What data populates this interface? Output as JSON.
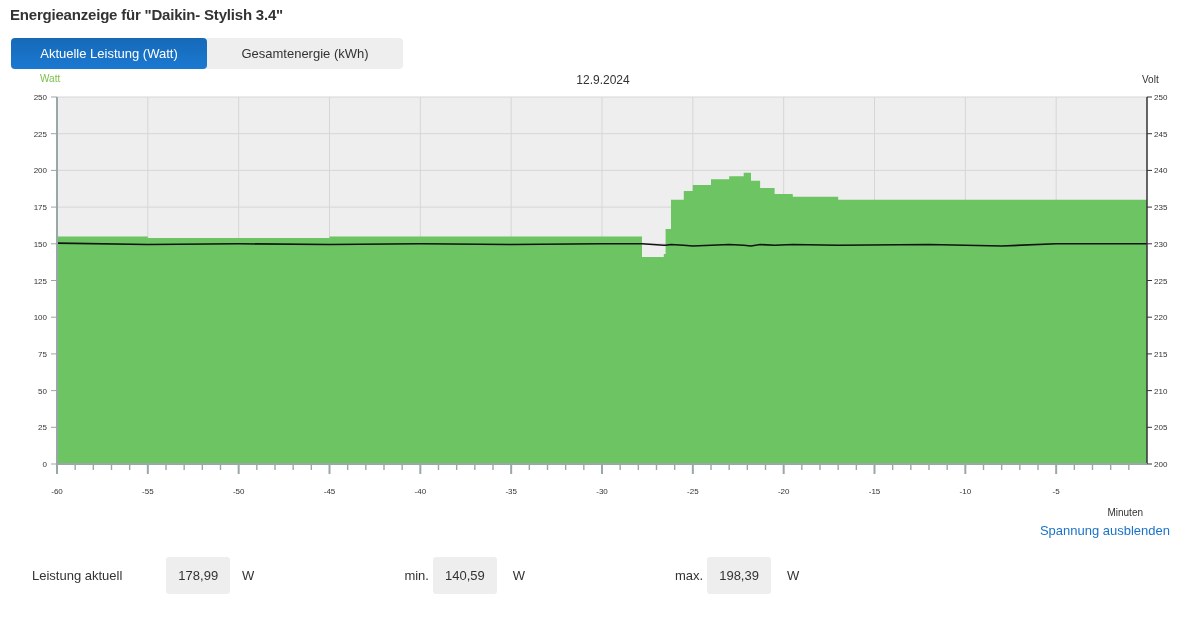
{
  "title": "Energieanzeige für \"Daikin- Stylish 3.4\"",
  "tabs": [
    {
      "label": "Aktuelle Leistung (Watt)",
      "selected": true
    },
    {
      "label": "Gesamtenergie (kWh)",
      "selected": false
    }
  ],
  "chart": {
    "chart_data": {
      "type": "area",
      "title": "12.9.2024",
      "xlabel": "Minuten",
      "ylabel": "Watt",
      "y2label": "Volt",
      "x": [
        -60,
        -55,
        -50,
        -45,
        -40,
        -35,
        -30,
        -28,
        -27.8,
        -26.6,
        -26.5,
        -26.2,
        -25.5,
        -25,
        -24,
        -23,
        -22.2,
        -21.8,
        -21.3,
        -20.5,
        -19.5,
        -17,
        -12,
        -8,
        -5,
        -2,
        0
      ],
      "series": [
        {
          "color": "#6cc463",
          "values": [
            155,
            154,
            154,
            155,
            155,
            155,
            155,
            155,
            141,
            143,
            160,
            180,
            186,
            190,
            194,
            196,
            198.4,
            193,
            188,
            184,
            182,
            180,
            180,
            180,
            180,
            180,
            179
          ]
        },
        {
          "type": "line",
          "color": "#111111",
          "axis": "y2",
          "values": [
            230.1,
            229.9,
            230,
            229.9,
            230,
            229.9,
            230,
            230,
            230,
            229.8,
            229.8,
            229.9,
            229.8,
            229.7,
            229.8,
            229.9,
            229.8,
            229.7,
            229.9,
            229.8,
            229.9,
            229.8,
            229.9,
            229.7,
            230,
            230,
            230
          ]
        }
      ],
      "grid": true,
      "xlim": [
        -60,
        0
      ],
      "ylim": [
        0,
        250
      ],
      "y2lim": [
        200,
        250
      ],
      "xticks": [
        -60,
        -55,
        -50,
        -45,
        -40,
        -35,
        -30,
        -25,
        -20,
        -15,
        -10,
        -5
      ],
      "yticks": [
        0,
        25,
        50,
        75,
        100,
        125,
        150,
        175,
        200,
        225,
        250
      ],
      "y2ticks": [
        200,
        205,
        210,
        215,
        220,
        225,
        230,
        235,
        240,
        245,
        250
      ]
    }
  },
  "toggle_link": "Spannung ausblenden",
  "stats": [
    {
      "label": "Leistung aktuell",
      "value": "178,99",
      "unit": "W"
    },
    {
      "label": "min.",
      "value": "140,59",
      "unit": "W"
    },
    {
      "label": "max.",
      "value": "198,39",
      "unit": "W"
    }
  ]
}
